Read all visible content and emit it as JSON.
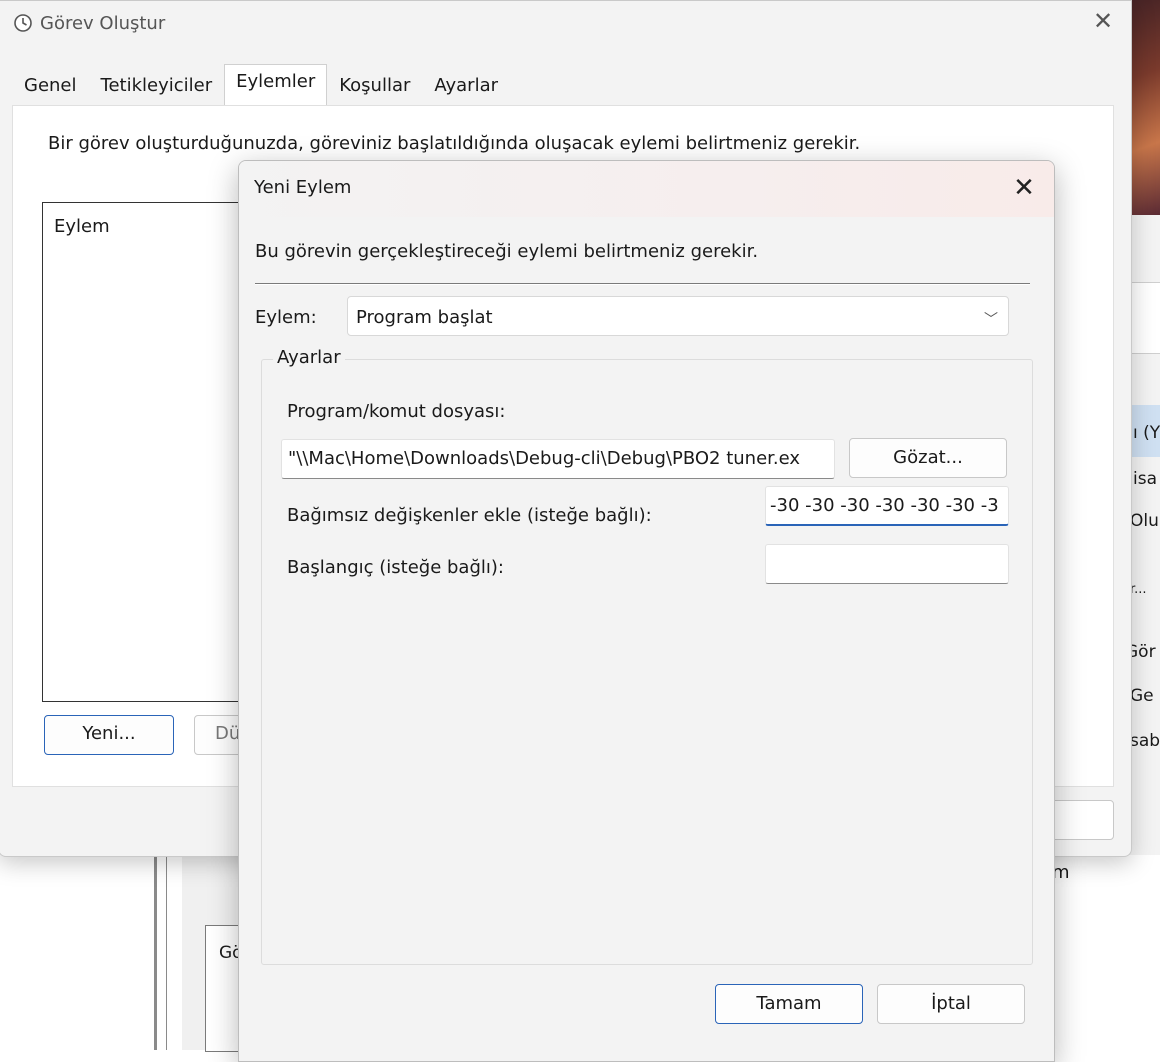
{
  "background": {
    "side_labels": [
      "ı (Y",
      "isa",
      "Olu",
      "r...",
      "Gör",
      "Ge",
      "sab"
    ],
    "bottom_label": "m",
    "group_label": "Gö"
  },
  "main_window": {
    "title": "Görev Oluştur",
    "close_glyph": "✕",
    "tabs": [
      "Genel",
      "Tetikleyiciler",
      "Eylemler",
      "Koşullar",
      "Ayarlar"
    ],
    "active_tab": "Eylemler",
    "description": "Bir görev oluşturduğunuzda, göreviniz başlatıldığında oluşacak eylemi belirtmeniz gerekir.",
    "list_header": "Eylem",
    "new_button": "Yeni...",
    "edit_button_partial": "Dü"
  },
  "dialog": {
    "title": "Yeni Eylem",
    "close_glyph": "✕",
    "description": "Bu görevin gerçekleştireceği eylemi belirtmeniz gerekir.",
    "action_label": "Eylem:",
    "action_value": "Program başlat",
    "settings_legend": "Ayarlar",
    "program_label": "Program/komut dosyası:",
    "program_value": "\"\\\\Mac\\Home\\Downloads\\Debug-cli\\Debug\\PBO2 tuner.ex",
    "browse_button": "Gözat...",
    "args_label": "Bağımsız değişkenler ekle (isteğe bağlı):",
    "args_value": "-30 -30 -30 -30 -30 -30 -3",
    "start_label": "Başlangıç (isteğe bağlı):",
    "start_value": "",
    "ok_button": "Tamam",
    "cancel_button": "İptal"
  }
}
